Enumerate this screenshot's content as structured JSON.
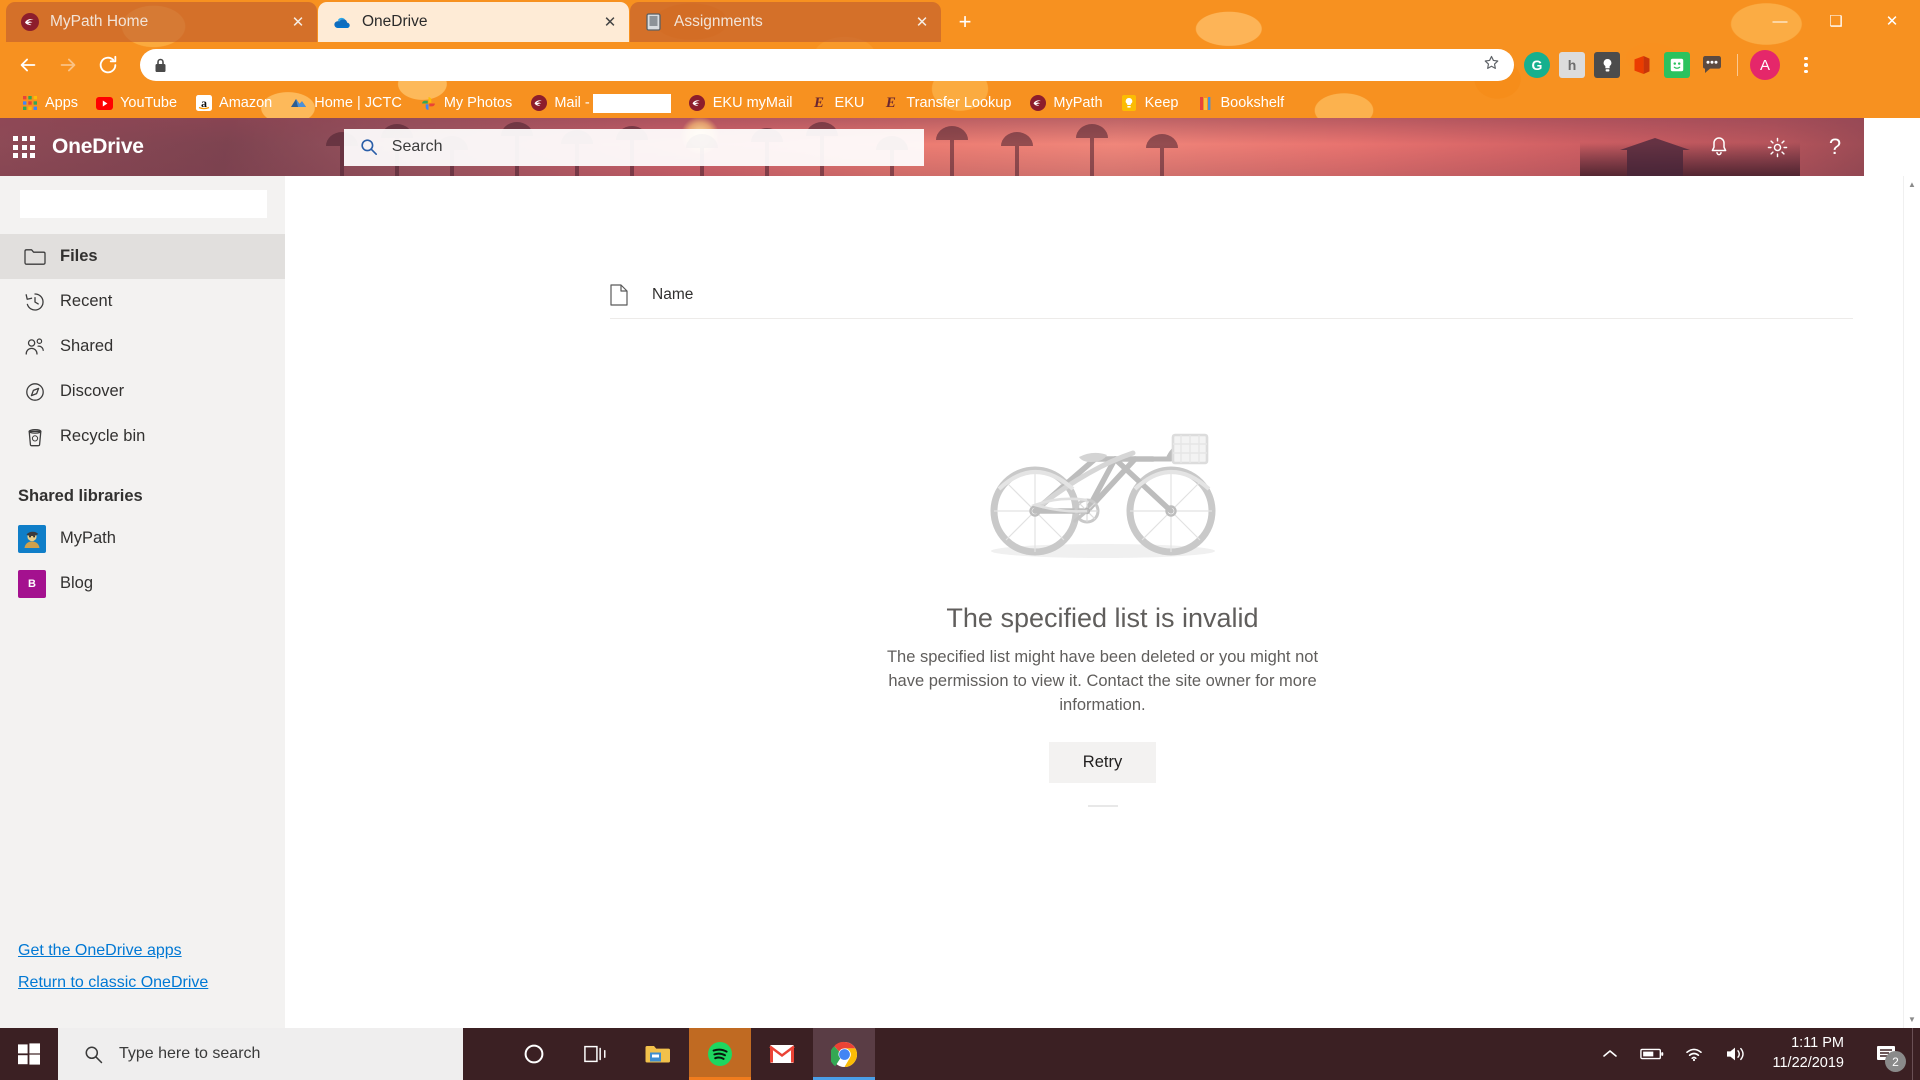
{
  "browser": {
    "tabs": [
      {
        "title": "MyPath Home",
        "favicon": "mypath-icon",
        "active": false,
        "close_label": "✕"
      },
      {
        "title": "OneDrive",
        "favicon": "onedrive-cloud-icon",
        "active": true,
        "close_label": "✕"
      },
      {
        "title": "Assignments",
        "favicon": "document-icon",
        "active": false,
        "close_label": "✕"
      }
    ],
    "new_tab_label": "+",
    "window_controls": {
      "minimize": "—",
      "maximize": "❑",
      "close": "✕"
    },
    "toolbar": {
      "back_icon": "back-arrow-icon",
      "forward_icon": "forward-arrow-icon",
      "reload_icon": "reload-icon",
      "lock_icon": "padlock-icon",
      "url_value": "",
      "url_placeholder": "",
      "bookmark_icon": "star-icon"
    },
    "extensions": [
      {
        "name": "grammarly-extension",
        "glyph": "G",
        "color": "#16b08e"
      },
      {
        "name": "honey-extension",
        "glyph": "h",
        "color": "#d8d8d8"
      },
      {
        "name": "lightbulb-extension",
        "glyph": "●",
        "color": "#4c4c4c"
      },
      {
        "name": "office-extension",
        "glyph": "",
        "color": "#e64a19"
      },
      {
        "name": "smiley-extension",
        "glyph": "☺",
        "color": "#2ecc71"
      },
      {
        "name": "chat-extension",
        "glyph": "…",
        "color": "#5b4a42"
      }
    ],
    "profile_initial": "A",
    "bookmarks": [
      {
        "label": "Apps",
        "icon": "apps-grid-icon"
      },
      {
        "label": "YouTube",
        "icon": "youtube-icon"
      },
      {
        "label": "Amazon",
        "icon": "amazon-icon"
      },
      {
        "label": "Home | JCTC",
        "icon": "jctc-icon"
      },
      {
        "label": "My Photos",
        "icon": "google-photos-icon"
      },
      {
        "label": "Mail -",
        "icon": "mypath-icon",
        "redacted": true
      },
      {
        "label": "EKU myMail",
        "icon": "mypath-icon"
      },
      {
        "label": "EKU",
        "icon": "eku-icon"
      },
      {
        "label": "Transfer Lookup",
        "icon": "eku-icon"
      },
      {
        "label": "MyPath",
        "icon": "mypath-icon"
      },
      {
        "label": "Keep",
        "icon": "google-keep-icon"
      },
      {
        "label": "Bookshelf",
        "icon": "bookshelf-icon"
      }
    ]
  },
  "onedrive": {
    "waffle_name": "app-launcher",
    "brand": "OneDrive",
    "search": {
      "placeholder": "Search",
      "value": ""
    },
    "header_icons": [
      {
        "name": "notifications-bell-icon",
        "glyph": " "
      },
      {
        "name": "settings-gear-icon",
        "glyph": " "
      },
      {
        "name": "help-question-icon",
        "glyph": "?"
      }
    ],
    "sidebar": {
      "search_value": "",
      "items": [
        {
          "label": "Files",
          "icon": "folder-icon",
          "active": true
        },
        {
          "label": "Recent",
          "icon": "clock-history-icon",
          "active": false
        },
        {
          "label": "Shared",
          "icon": "people-icon",
          "active": false
        },
        {
          "label": "Discover",
          "icon": "compass-icon",
          "active": false
        },
        {
          "label": "Recycle bin",
          "icon": "trash-icon",
          "active": false
        }
      ],
      "shared_libraries_heading": "Shared libraries",
      "libraries": [
        {
          "label": "MyPath",
          "icon": "mypath-library-icon",
          "color": "#0f7ec8",
          "initial": ""
        },
        {
          "label": "Blog",
          "icon": "blog-library-icon",
          "color": "#a4118f",
          "initial": "B"
        }
      ],
      "footer_links": [
        {
          "label": "Get the OneDrive apps"
        },
        {
          "label": "Return to classic OneDrive"
        }
      ]
    },
    "file_list": {
      "columns": [
        {
          "label": "Name",
          "icon": "document-column-icon"
        }
      ],
      "rows": []
    },
    "empty_state": {
      "illustration": "bicycle-illustration",
      "title": "The specified list is invalid",
      "description": "The specified list might have been deleted or you might not have permission to view it. Contact the site owner for more information.",
      "retry_label": "Retry"
    }
  },
  "taskbar": {
    "start_icon": "windows-start-icon",
    "search_placeholder": "Type here to search",
    "search_icon": "search-icon",
    "items": [
      {
        "name": "cortana-icon",
        "bar": ""
      },
      {
        "name": "task-view-icon",
        "bar": ""
      },
      {
        "name": "file-explorer-icon",
        "bar": ""
      },
      {
        "name": "spotify-icon",
        "bar": "#f07c1e"
      },
      {
        "name": "gmail-icon",
        "bar": ""
      },
      {
        "name": "chrome-icon",
        "bar": "#4a9fe8"
      }
    ],
    "tray": [
      {
        "name": "show-hidden-icons-chevron"
      },
      {
        "name": "battery-icon"
      },
      {
        "name": "wifi-icon"
      },
      {
        "name": "volume-icon"
      }
    ],
    "time": "1:11 PM",
    "date": "11/22/2019",
    "notification_count": "2",
    "notification_icon": "action-center-icon"
  }
}
